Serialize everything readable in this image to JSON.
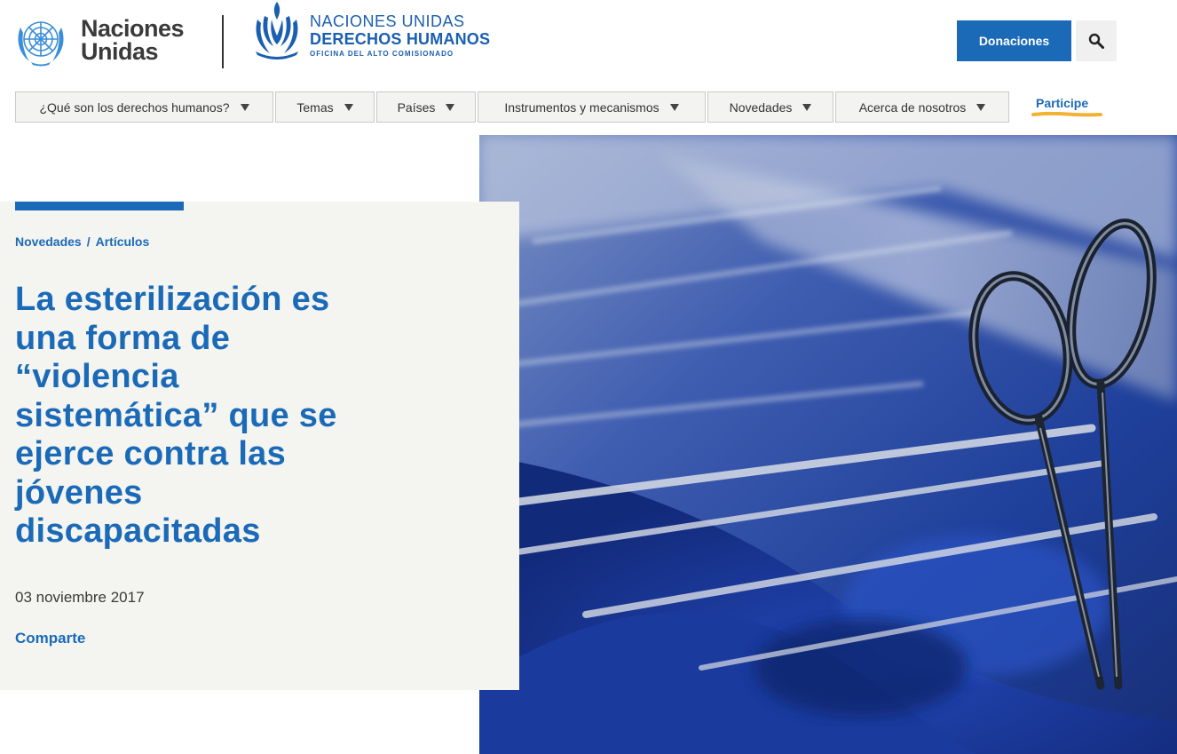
{
  "header": {
    "un_logo_line1": "Naciones",
    "un_logo_line2": "Unidas",
    "ohchr_line1": "NACIONES UNIDAS",
    "ohchr_line2": "DERECHOS HUMANOS",
    "ohchr_line3": "OFICINA DEL ALTO COMISIONADO",
    "donate_label": "Donaciones"
  },
  "nav": {
    "items": [
      {
        "label": "¿Qué son los derechos humanos?"
      },
      {
        "label": "Temas"
      },
      {
        "label": "Países"
      },
      {
        "label": "Instrumentos y mecanismos"
      },
      {
        "label": "Novedades"
      },
      {
        "label": "Acerca de nosotros"
      }
    ],
    "participe_label": "Participe"
  },
  "article": {
    "breadcrumb": [
      "Novedades",
      "Artículos"
    ],
    "breadcrumb_separator": "/",
    "title": "La esterilización es una forma de “violencia sistemática” que se ejerce contra las jóvenes discapacitadas",
    "date": "03 noviembre 2017",
    "share_label": "Comparte"
  },
  "colors": {
    "brand_blue": "#1b6ab8",
    "panel_bg": "#f4f4f0",
    "participe_underline": "#f2b232"
  },
  "icons": {
    "search": "search-icon",
    "caret": "caret-down-icon",
    "un_emblem": "un-emblem-icon",
    "ohchr_emblem": "ohchr-emblem-icon"
  }
}
